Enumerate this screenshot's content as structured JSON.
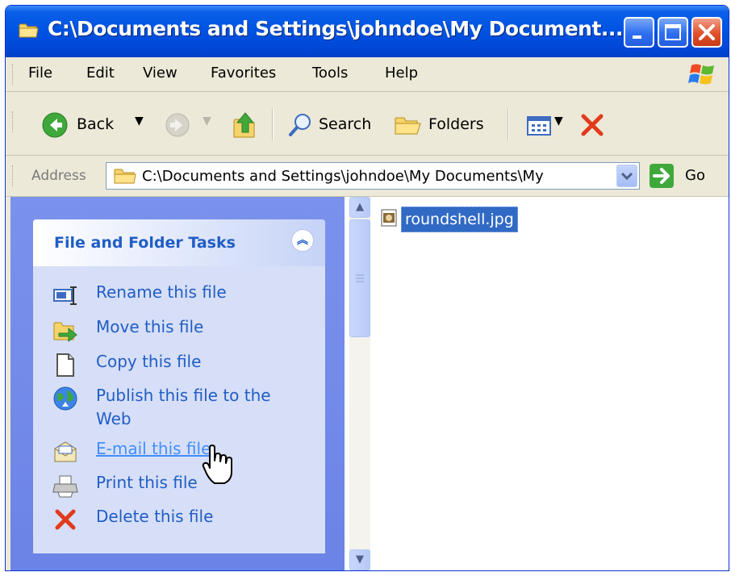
{
  "window": {
    "title": "C:\\Documents and Settings\\johndoe\\My Document..."
  },
  "menubar": {
    "items": [
      "File",
      "Edit",
      "View",
      "Favorites",
      "Tools",
      "Help"
    ]
  },
  "toolbar": {
    "back_label": "Back",
    "search_label": "Search",
    "folders_label": "Folders"
  },
  "addressbar": {
    "label": "Address",
    "value": "C:\\Documents and Settings\\johndoe\\My Documents\\My",
    "go_label": "Go"
  },
  "tasks": {
    "title": "File and Folder Tasks",
    "items": [
      {
        "label": "Rename this file",
        "icon": "rename-icon"
      },
      {
        "label": "Move this file",
        "icon": "move-icon"
      },
      {
        "label": "Copy this file",
        "icon": "copy-icon"
      },
      {
        "label": "Publish this file to the Web",
        "icon": "globe-icon"
      },
      {
        "label": "E-mail this file",
        "icon": "email-icon"
      },
      {
        "label": "Print this file",
        "icon": "printer-icon"
      },
      {
        "label": "Delete this file",
        "icon": "delete-icon"
      }
    ]
  },
  "files": [
    {
      "name": "roundshell.jpg",
      "icon": "image-file-icon",
      "selected": true
    }
  ],
  "colors": {
    "titlebar": "#0054e3",
    "task_link": "#215dc6",
    "selection": "#316ac5",
    "taskpane_bg": "#6b83e6"
  }
}
